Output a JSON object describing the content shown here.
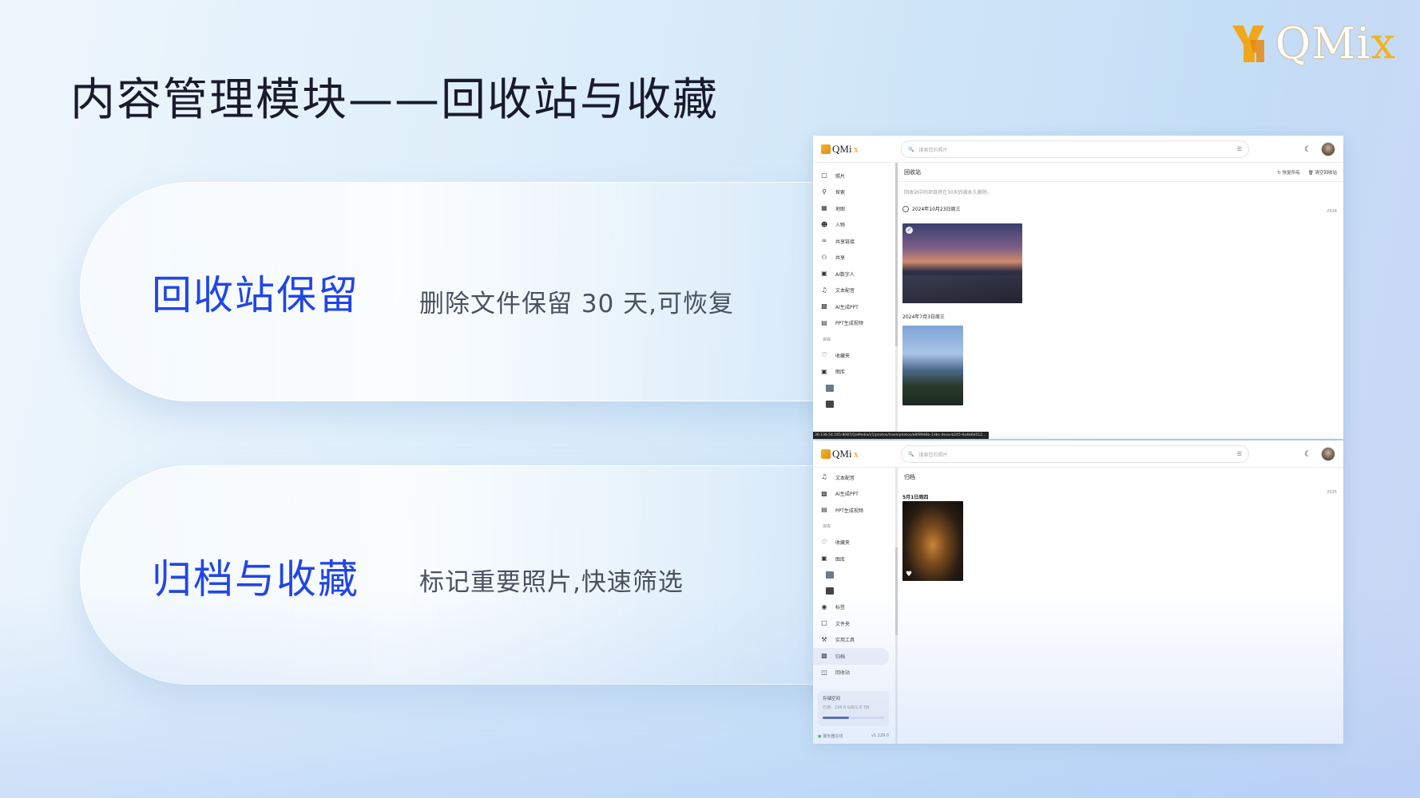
{
  "slide": {
    "title": "内容管理模块——回收站与收藏",
    "logo_text": "QMi",
    "logo_x": "x"
  },
  "features": [
    {
      "heading": "回收站保留",
      "desc": "删除文件保留 30 天,可恢复"
    },
    {
      "heading": "归档与收藏",
      "desc": "标记重要照片,快速筛选"
    }
  ],
  "app": {
    "brand": "QMi",
    "brand_x": "x",
    "search_placeholder": "搜索您的照片",
    "filter_icon": "filter-icon"
  },
  "screen1": {
    "sidebar": [
      "照片",
      "探索",
      "地图",
      "人物",
      "共享链接",
      "共享",
      "AI数字人",
      "文本配音",
      "AI生成PPT",
      "PPT生成视频"
    ],
    "group_label": "资库",
    "library_items": [
      "收藏夹",
      "图库"
    ],
    "header": "回收站",
    "action_restore": "恢复所有",
    "action_empty": "清空回收站",
    "note": "回收站中的项目将在30天后被永久删除。",
    "date1": "2024年10月23日周三",
    "year1": "2024",
    "date2": "2024年7月3日周三",
    "url": "36.136.54.165:8087/QaMedia/i/1/photos/trash/photos/b8f89d6b-1dbc-4eaa-b245-6a4b6d512..."
  },
  "screen2": {
    "sidebar_top": [
      "文本配音",
      "AI生成PPT",
      "PPT生成视频"
    ],
    "group_label": "资库",
    "library_items": [
      "收藏夹",
      "图库"
    ],
    "more_items": [
      "标签",
      "文件夹",
      "实用工具",
      "归档",
      "回收站"
    ],
    "active_item": "归档",
    "header": "归档",
    "date1": "5月1日周四",
    "year1": "2025",
    "storage_title": "存储空间",
    "storage_used": "已用：196.8 GiB/1.8 TiB",
    "storage_fraction": 0.107,
    "status_online": "服务器在线",
    "version": "v1.129.0"
  }
}
